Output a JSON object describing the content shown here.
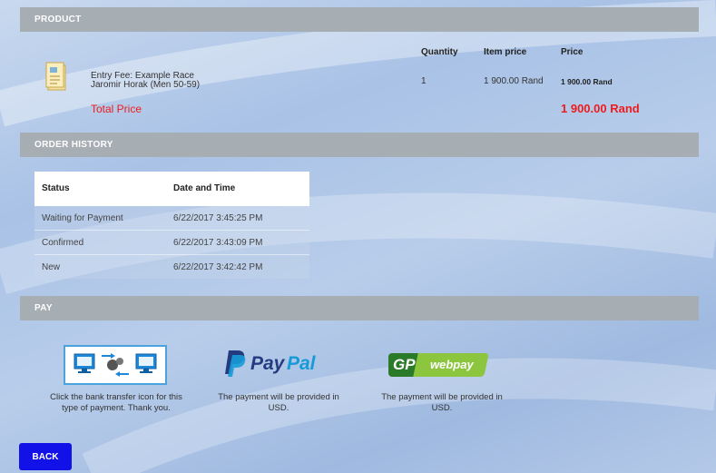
{
  "product": {
    "header": "PRODUCT",
    "columns": {
      "quantity": "Quantity",
      "item_price": "Item price",
      "price": "Price"
    },
    "item": {
      "name": "Entry Fee: Example Race",
      "person": "Jaromir Horak (Men 50-59)",
      "quantity": "1",
      "item_price": "1 900.00 Rand",
      "price": "1 900.00 Rand"
    },
    "total_label": "Total Price",
    "total_value": "1 900.00 Rand"
  },
  "order_history": {
    "header": "ORDER HISTORY",
    "columns": [
      "Status",
      "Date and Time"
    ],
    "rows": [
      [
        "Waiting for Payment",
        "6/22/2017 3:45:25 PM"
      ],
      [
        "Confirmed",
        "6/22/2017 3:43:09 PM"
      ],
      [
        "New",
        "6/22/2017 3:42:42 PM"
      ]
    ]
  },
  "pay": {
    "header": "PAY",
    "bank_caption": "Click the bank transfer icon for this type of payment. Thank you.",
    "paypal_logo": {
      "pay": "Pay",
      "pal": "Pal"
    },
    "paypal_caption": "The payment will be provided in USD.",
    "gp_logo": {
      "gp": "GP",
      "webpay": "webpay"
    },
    "gp_caption": "The payment will be provided in USD."
  },
  "back_label": "BACK",
  "colors": {
    "accent_red": "#ee1c1c",
    "back_blue": "#1111e8",
    "bar_gray": "#a6adb3"
  }
}
